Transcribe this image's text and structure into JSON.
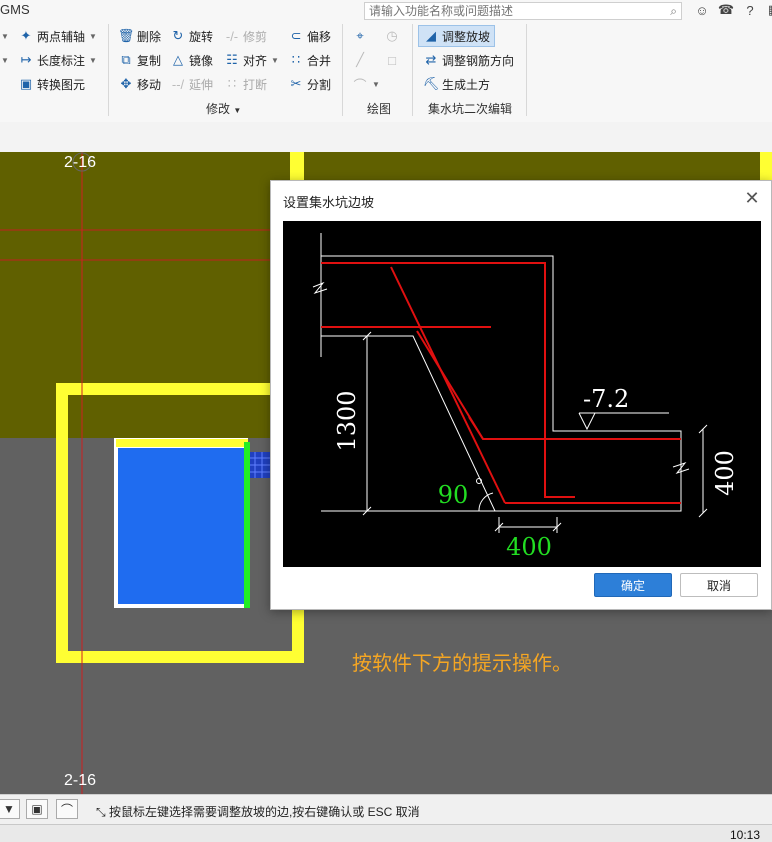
{
  "app": {
    "title": "GMS"
  },
  "search": {
    "placeholder": "请输入功能名称或问题描述"
  },
  "ribbon": {
    "col1": {
      "two_point_axis": "两点辅轴",
      "length_dim": "长度标注",
      "convert_element": "转换图元"
    },
    "modify": {
      "delete": "删除",
      "rotate": "旋转",
      "trim": "修剪",
      "offset": "偏移",
      "copy": "复制",
      "mirror": "镜像",
      "align": "对齐",
      "merge": "合并",
      "move": "移动",
      "extend": "延伸",
      "break": "打断",
      "split": "分割",
      "group_label": "修改"
    },
    "draw": {
      "group_label": "绘图"
    },
    "sump_edit": {
      "adjust_slope": "调整放坡",
      "adjust_rebar_dir": "调整钢筋方向",
      "generate_earthwork": "生成土方",
      "group_label": "集水坑二次编辑"
    }
  },
  "canvas": {
    "axis_top": "2-16",
    "axis_bottom": "2-16",
    "hint": "按软件下方的提示操作。"
  },
  "dialog": {
    "title": "设置集水坑边坡",
    "preview": {
      "elevation": "-7.2",
      "depth": "1300",
      "angle": "90",
      "bottom_width": "400",
      "thickness": "400"
    },
    "ok": "确定",
    "cancel": "取消"
  },
  "statusbar": {
    "hint": "按鼠标左键选择需要调整放坡的边,按右键确认或 ESC 取消"
  },
  "taskbar": {
    "clock": "10:13"
  },
  "colors": {
    "accent": "#2d7fd8",
    "hint": "#f5a623",
    "slab": "#606000",
    "pit": "#1f6cf0",
    "wall": "#ffff33",
    "rebar": "#e01010"
  }
}
